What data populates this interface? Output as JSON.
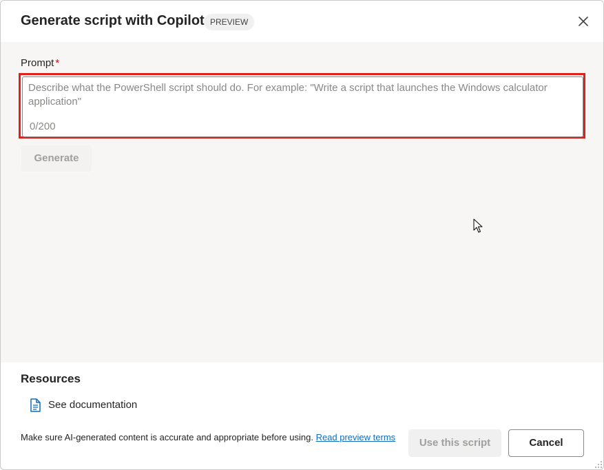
{
  "dialog": {
    "title": "Generate script with Copilot",
    "badge": "PREVIEW",
    "close_icon": "close-icon"
  },
  "prompt": {
    "label": "Prompt",
    "required_marker": "*",
    "value": "",
    "placeholder": "Describe what the PowerShell script should do. For example: \"Write a script that launches the Windows calculator application\"",
    "counter": "0/200",
    "generate_label": "Generate"
  },
  "resources": {
    "title": "Resources",
    "items": [
      {
        "icon": "document-icon",
        "label": "See documentation"
      }
    ]
  },
  "footer": {
    "disclaimer": "Make sure AI-generated content is accurate and appropriate before using.",
    "link_text": "Read preview terms",
    "use_script_label": "Use this script",
    "cancel_label": "Cancel"
  },
  "colors": {
    "highlight": "#e0201b",
    "link": "#0f6cbd",
    "required": "#c50f1f",
    "body_background": "#f7f6f4"
  }
}
